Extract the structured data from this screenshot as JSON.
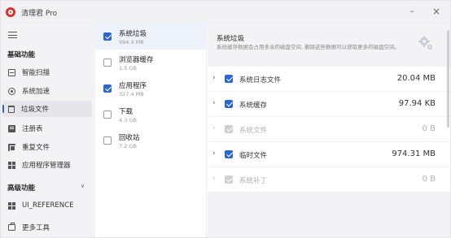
{
  "app": {
    "title": "清理君 Pro"
  },
  "window": {
    "minimize": "–",
    "close": "×"
  },
  "sidebar": {
    "basic_title": "基础功能",
    "basic_items": [
      {
        "label": "智能扫描",
        "icon": "scan-icon"
      },
      {
        "label": "系统加速",
        "icon": "speed-icon"
      },
      {
        "label": "垃圾文件",
        "icon": "trash-icon"
      },
      {
        "label": "注册表",
        "icon": "registry-icon"
      },
      {
        "label": "重复文件",
        "icon": "duplicate-icon"
      },
      {
        "label": "应用程序管理器",
        "icon": "apps-icon"
      }
    ],
    "advanced_title": "高级功能",
    "advanced_items": [
      {
        "label": "UI_REFERENCE",
        "icon": "grid-icon"
      },
      {
        "label": "更多工具",
        "icon": "tools-icon"
      }
    ]
  },
  "categories": [
    {
      "name": "系统垃圾",
      "size": "994.4 MB",
      "checked": true
    },
    {
      "name": "浏览器缓存",
      "size": "1.5 GB",
      "checked": false
    },
    {
      "name": "应用程序",
      "size": "327.4 MB",
      "checked": true
    },
    {
      "name": "下载",
      "size": "4.3 GB",
      "checked": false
    },
    {
      "name": "回收站",
      "size": "7.2 GB",
      "checked": false
    }
  ],
  "detail": {
    "title": "系统垃圾",
    "description": "系统缓存数据会占用多余的磁盘空间, 删除这些数据可以获取更多的磁盘空间。",
    "rows": [
      {
        "name": "系统日志文件",
        "size": "20.04 MB",
        "enabled": true
      },
      {
        "name": "系统缓存",
        "size": "97.94 KB",
        "enabled": true
      },
      {
        "name": "系统文件",
        "size": "0 B",
        "enabled": false
      },
      {
        "name": "临时文件",
        "size": "974.31 MB",
        "enabled": true
      },
      {
        "name": "系统补丁",
        "size": "0 B",
        "enabled": false
      }
    ]
  },
  "colors": {
    "accent": "#2e67cc",
    "logo": "#d9302c"
  }
}
